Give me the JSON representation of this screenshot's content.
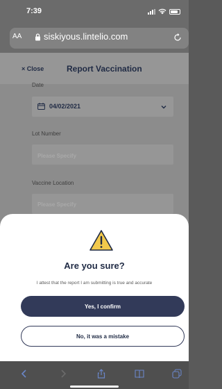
{
  "status_bar": {
    "time": "7:39"
  },
  "browser": {
    "text_size_label": "AA",
    "url": "siskiyous.lintelio.com"
  },
  "page": {
    "close_label": "× Close",
    "title": "Report Vaccination",
    "form": {
      "date_label": "Date",
      "date_value": "04/02/2021",
      "lot_label": "Lot Number",
      "lot_placeholder": "Please Specify",
      "location_label": "Vaccine Location",
      "location_placeholder": "Please Specify"
    }
  },
  "modal": {
    "title": "Are you sure?",
    "message": "I attest that the report I am submitting is true and accurate",
    "confirm_label": "Yes, I confirm",
    "cancel_label": "No, it was a mistake"
  },
  "icons": {
    "warning": "warning-triangle-icon",
    "lock": "lock-icon",
    "reload": "reload-icon",
    "calendar": "calendar-icon"
  },
  "colors": {
    "primary": "#323a59",
    "warning": "#f2c94c"
  }
}
